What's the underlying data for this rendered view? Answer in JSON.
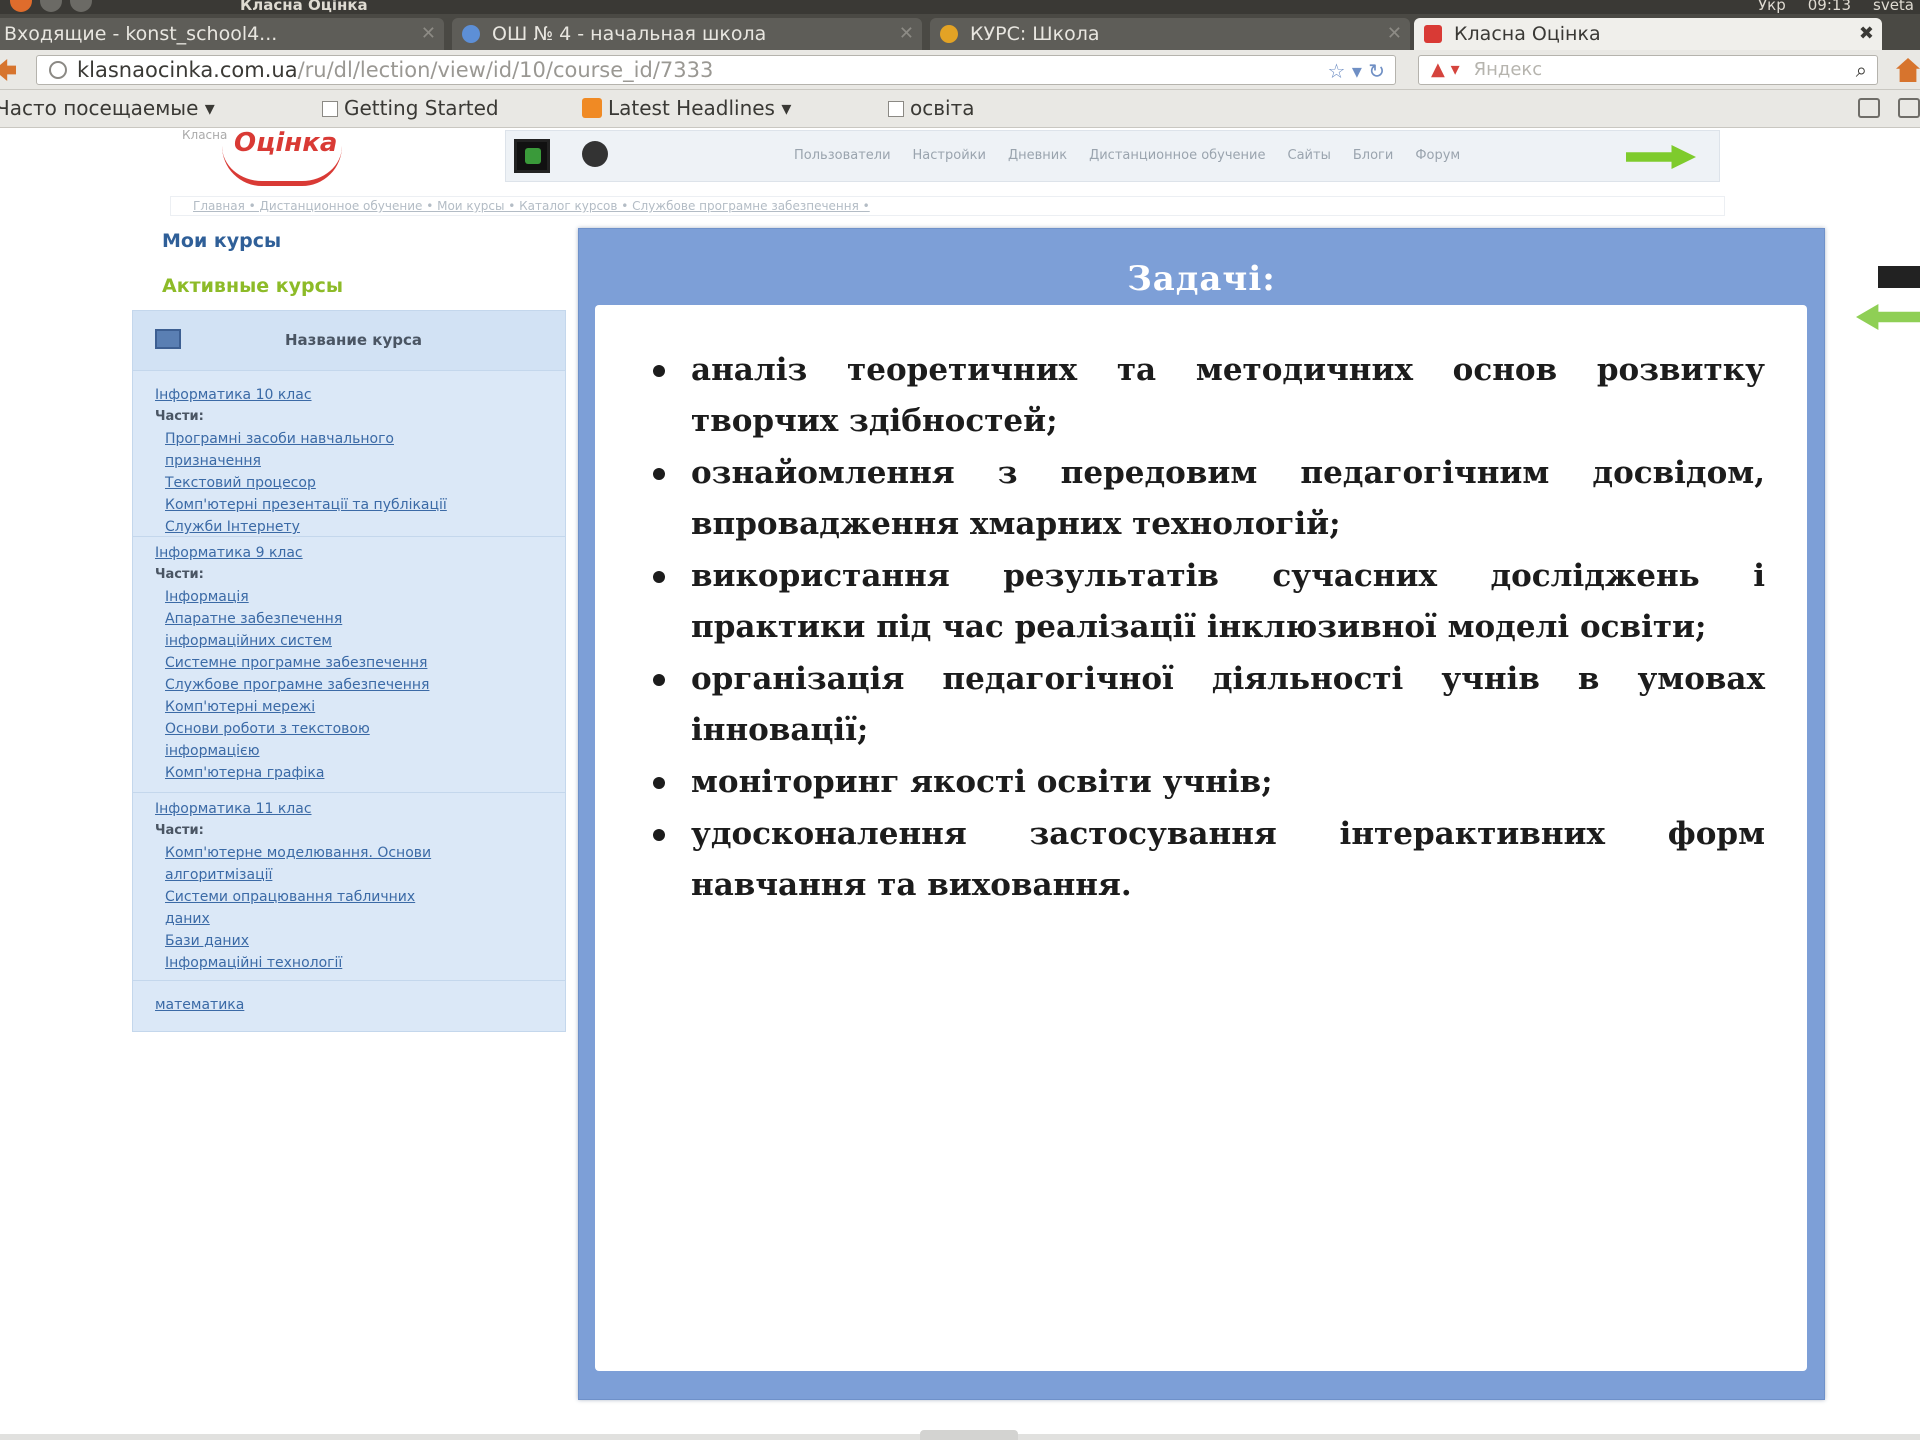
{
  "window": {
    "title": "Класна Оцінка",
    "tray": [
      "Укр",
      "09:13",
      "sveta"
    ]
  },
  "tabs": [
    {
      "label": "Входящие - konst_school4...",
      "active": false
    },
    {
      "label": "ОШ № 4 - начальная школа",
      "active": false
    },
    {
      "label": "КУРС: Школа",
      "active": false
    },
    {
      "label": "Класна Оцінка",
      "active": true
    }
  ],
  "address": {
    "domain": "klasnaocinka.com.ua",
    "path": "/ru/dl/lection/view/id/10/course_id/7333"
  },
  "search": {
    "placeholder": "Яндекс"
  },
  "bookmarks": [
    {
      "label": "Часто посещаемые ▾"
    },
    {
      "label": "Getting Started"
    },
    {
      "label": "Latest Headlines ▾"
    },
    {
      "label": "освіта"
    }
  ],
  "site": {
    "logo_small": "Класна",
    "logo_main": "Оцінка",
    "nav": [
      "Пользователи",
      "Настройки",
      "Дневник",
      "Дистанционное обучение",
      "Сайты",
      "Блоги",
      "Форум"
    ],
    "breadcrumb": "Главная • Дистанционное обучение • Мои курсы • Каталог курсов • Службове програмне забезпечення •"
  },
  "sidebar": {
    "my_courses": "Мои курсы",
    "active_courses": "Активные курсы",
    "panel_title": "Название курса",
    "groups": [
      {
        "name": "Інформатика 10 клас",
        "parts_label": "Части:",
        "parts": [
          "Програмні засоби навчального",
          "призначення",
          "Текстовий процесор",
          "Комп'ютерні презентації та публікації",
          "Служби Інтернету"
        ]
      },
      {
        "name": "Інформатика 9 клас",
        "parts_label": "Части:",
        "parts": [
          "Інформація",
          "Апаратне забезпечення",
          "інформаційних систем",
          "Системне програмне забезпечення",
          "Службове програмне забезпечення",
          "Комп'ютерні мережі",
          "Основи роботи з текстовою",
          "інформацією",
          "Комп'ютерна графіка"
        ]
      },
      {
        "name": "Інформатика 11 клас",
        "parts_label": "Части:",
        "parts": [
          "Комп'ютерне моделювання. Основи",
          "алгоритмізації",
          "Системи опрацювання табличних",
          "даних",
          "Бази даних",
          "Інформаційні технології"
        ]
      },
      {
        "name": "математика",
        "parts_label": "",
        "parts": []
      }
    ]
  },
  "slide": {
    "title": "Задачі:",
    "items": [
      "аналіз теоретичних та методичних основ розвитку творчих здібностей;",
      "ознайомлення з передовим педагогічним досвідом, впровадження хмарних технологій;",
      "використання результатів сучасних досліджень і практики під час реалізації інклюзивної моделі освіти;",
      "організація педагогічної діяльності учнів в умовах інновації;",
      "моніторинг якості освіти учнів;",
      "удосконалення застосування інтерактивних форм навчання та виховання."
    ]
  }
}
